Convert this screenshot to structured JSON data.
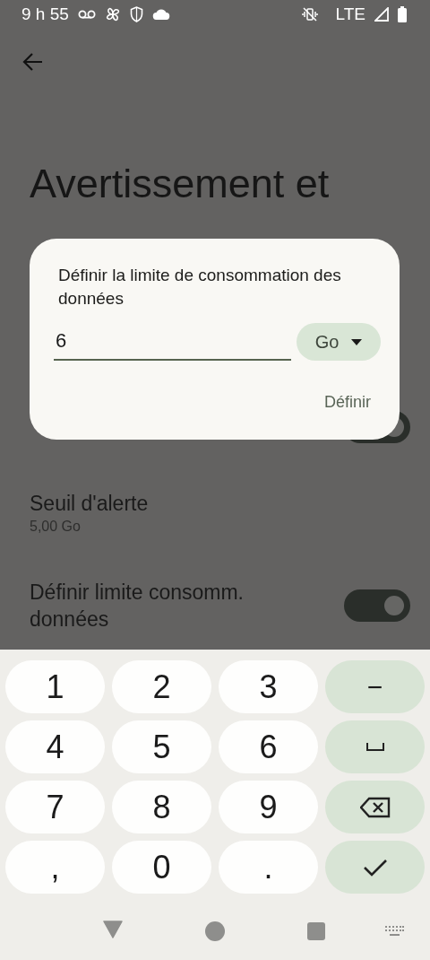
{
  "status_bar": {
    "time": "9 h 55",
    "network": "LTE"
  },
  "page": {
    "title": "Avertissement et",
    "rows": [
      {
        "kind": "switch",
        "on": true
      },
      {
        "kind": "value",
        "title": "Seuil d'alerte",
        "summary": "5,00 Go"
      },
      {
        "kind": "switch",
        "title": "Définir limite consomm. données",
        "on": true
      }
    ]
  },
  "dialog": {
    "title": "Définir la limite de consommation des données",
    "value": "6",
    "unit": "Go",
    "action": "Définir"
  },
  "keyboard": {
    "keys": [
      {
        "kind": "digit",
        "label": "1"
      },
      {
        "kind": "digit",
        "label": "2"
      },
      {
        "kind": "digit",
        "label": "3"
      },
      {
        "kind": "symbol",
        "label": "−"
      },
      {
        "kind": "digit",
        "label": "4"
      },
      {
        "kind": "digit",
        "label": "5"
      },
      {
        "kind": "digit",
        "label": "6"
      },
      {
        "kind": "space"
      },
      {
        "kind": "digit",
        "label": "7"
      },
      {
        "kind": "digit",
        "label": "8"
      },
      {
        "kind": "digit",
        "label": "9"
      },
      {
        "kind": "backspace"
      },
      {
        "kind": "digit",
        "label": ","
      },
      {
        "kind": "digit",
        "label": "0"
      },
      {
        "kind": "digit",
        "label": "."
      },
      {
        "kind": "enter"
      }
    ]
  }
}
